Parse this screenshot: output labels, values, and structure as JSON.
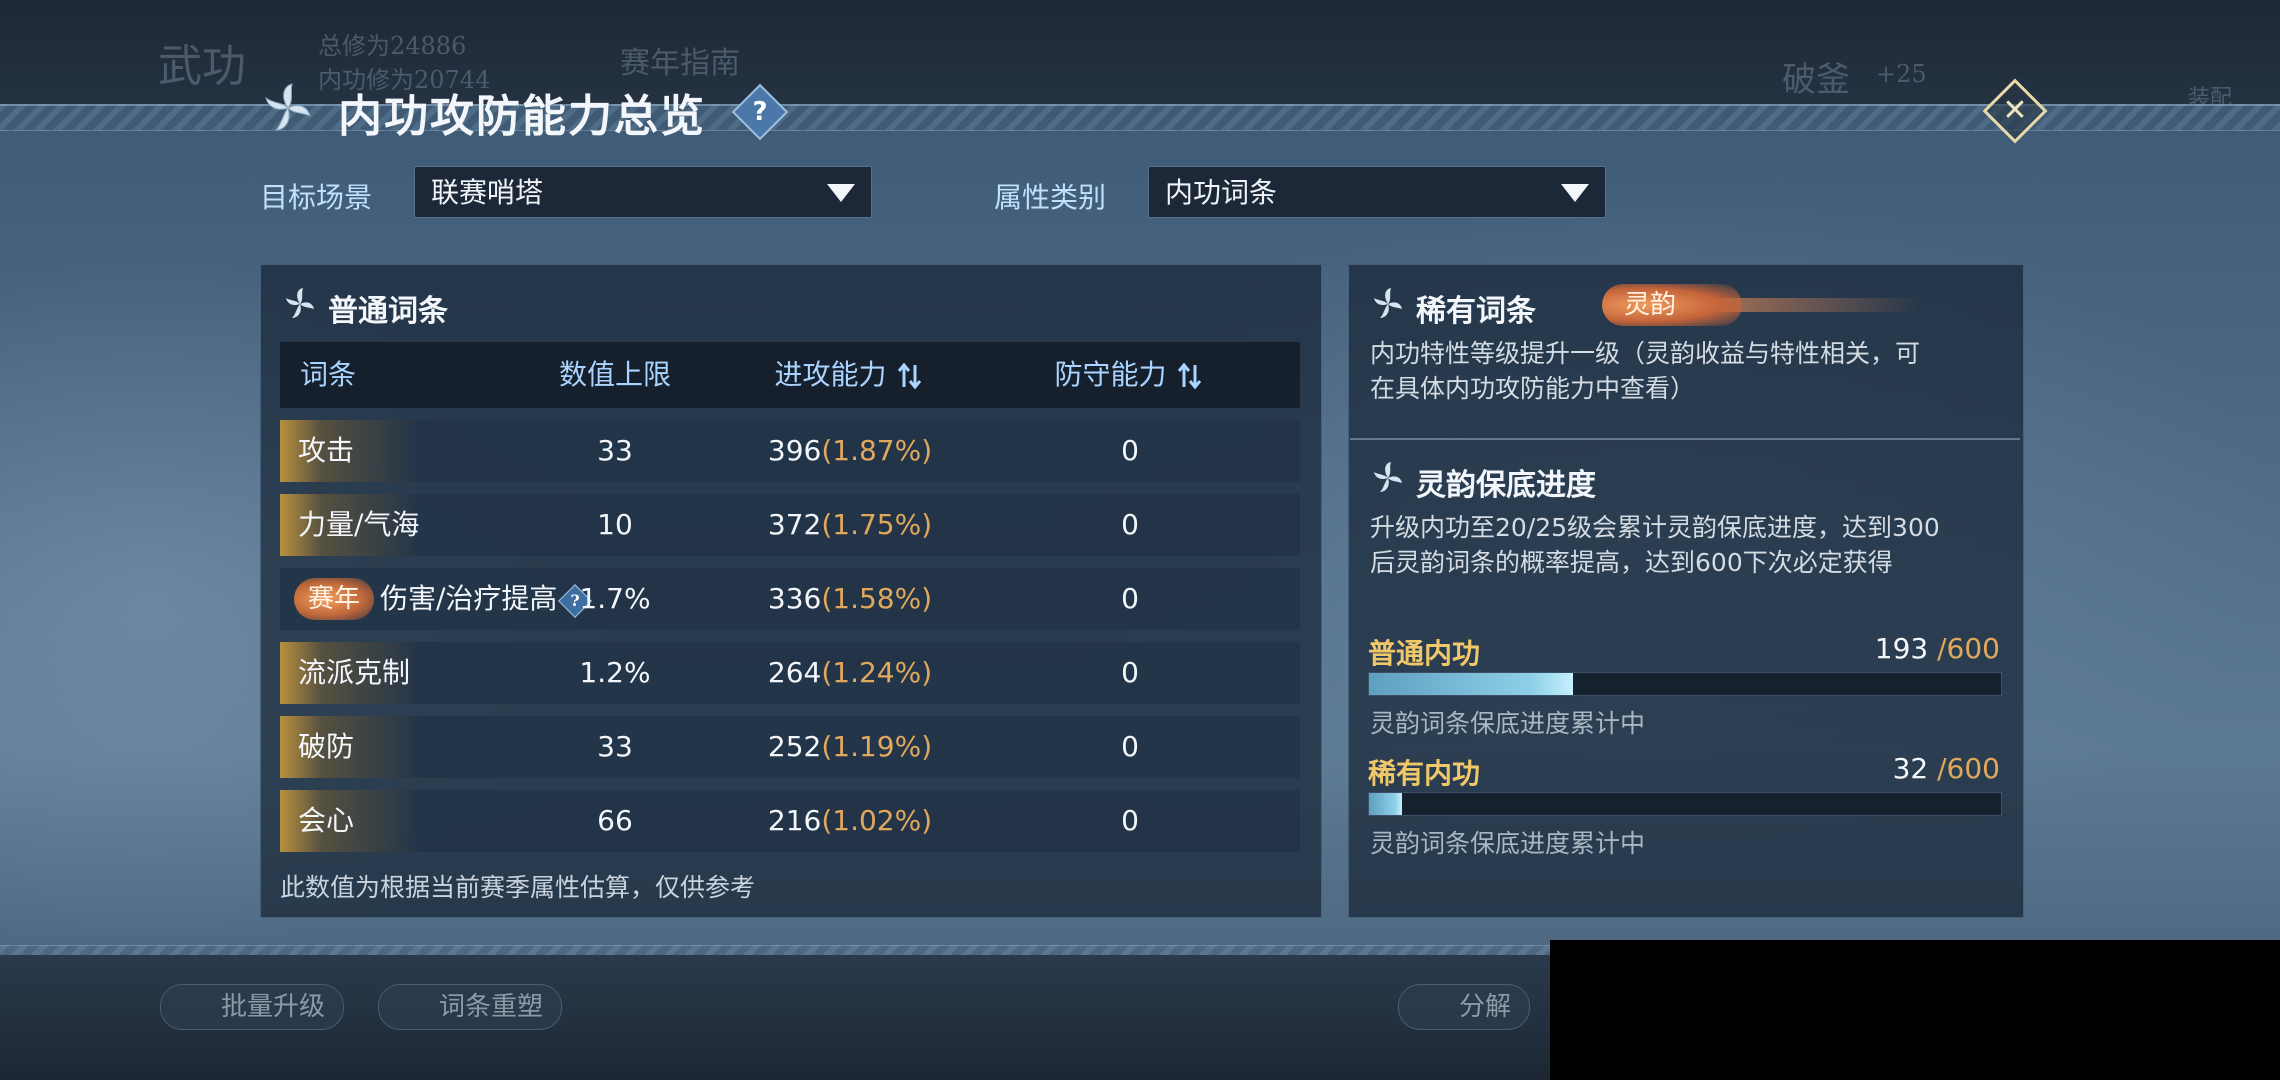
{
  "background": {
    "section_title": "武功",
    "total_cultivation": "总修为24886",
    "internal_cultivation": "内功修为20744",
    "guide_button": "赛年指南",
    "skill_name": "破釜",
    "skill_bonus": "+25",
    "equip_button": "装配",
    "batch_upgrade_button": "批量升级",
    "reshape_button": "词条重塑",
    "decompose_button": "分解"
  },
  "modal": {
    "title": "内功攻防能力总览",
    "help_glyph": "?",
    "close_glyph": "✕",
    "filters": {
      "scene_label": "目标场景",
      "scene_value": "联赛哨塔",
      "category_label": "属性类别",
      "category_value": "内功词条"
    },
    "common": {
      "title": "普通词条",
      "headers": {
        "name": "词条",
        "max": "数值上限",
        "attack": "进攻能力",
        "defense": "防守能力"
      },
      "rows": [
        {
          "name": "攻击",
          "max": "33",
          "attack": "396",
          "attack_pct": "(1.87%)",
          "defense": "0"
        },
        {
          "name": "力量/气海",
          "max": "10",
          "attack": "372",
          "attack_pct": "(1.75%)",
          "defense": "0"
        },
        {
          "badge": "赛年",
          "name": "伤害/治疗提高",
          "help": "?",
          "max": "1.7%",
          "attack": "336",
          "attack_pct": "(1.58%)",
          "defense": "0"
        },
        {
          "name": "流派克制",
          "max": "1.2%",
          "attack": "264",
          "attack_pct": "(1.24%)",
          "defense": "0"
        },
        {
          "name": "破防",
          "max": "33",
          "attack": "252",
          "attack_pct": "(1.19%)",
          "defense": "0"
        },
        {
          "name": "会心",
          "max": "66",
          "attack": "216",
          "attack_pct": "(1.02%)",
          "defense": "0"
        }
      ],
      "note": "此数值为根据当前赛季属性估算，仅供参考"
    },
    "rare": {
      "title": "稀有词条",
      "badge": "灵韵",
      "desc_line1": "内功特性等级提升一级（灵韵收益与特性相关，可",
      "desc_line2": "在具体内功攻防能力中查看）"
    },
    "guarantee": {
      "title": "灵韵保底进度",
      "desc_line1": "升级内功至20/25级会累计灵韵保底进度，达到300",
      "desc_line2": "后灵韵词条的概率提高，达到600下次必定获得",
      "items": [
        {
          "label": "普通内功",
          "current": "193",
          "max": " /600",
          "fill": 0.322,
          "note": "灵韵词条保底进度累计中"
        },
        {
          "label": "稀有内功",
          "current": "32",
          "max": " /600",
          "fill": 0.053,
          "note": "灵韵词条保底进度累计中"
        }
      ]
    }
  },
  "colors": {
    "accent_gold": "#f0c86a",
    "pct_orange": "#e1a85c",
    "header_blue": "#a9d4ff",
    "progress_fill": "#8fd0e8"
  }
}
